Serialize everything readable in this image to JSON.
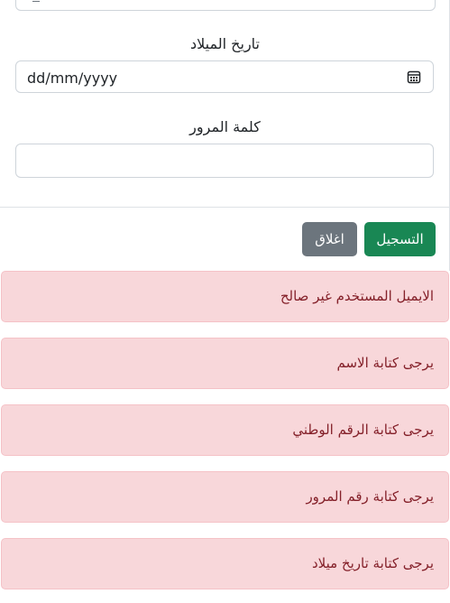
{
  "form": {
    "birthdate_label": "تاريخ الميلاد",
    "birthdate_value": "dd/mm/yyyy",
    "password_label": "كلمة المرور",
    "password_value": ""
  },
  "buttons": {
    "register": "التسجيل",
    "close": "اغلاق"
  },
  "alerts": [
    "الايميل المستخدم غير صالح",
    "يرجى كتابة الاسم",
    "يرجى كتابة الرقم الوطني",
    "يرجى كتابة رقم المرور",
    "يرجى كتابة تاريخ ميلاد"
  ],
  "colors": {
    "primary": "#198754",
    "secondary": "#6c757d",
    "alert_bg": "#f8d7da",
    "alert_text": "#842029"
  },
  "icons": {
    "date_picker": "calendar-icon"
  }
}
